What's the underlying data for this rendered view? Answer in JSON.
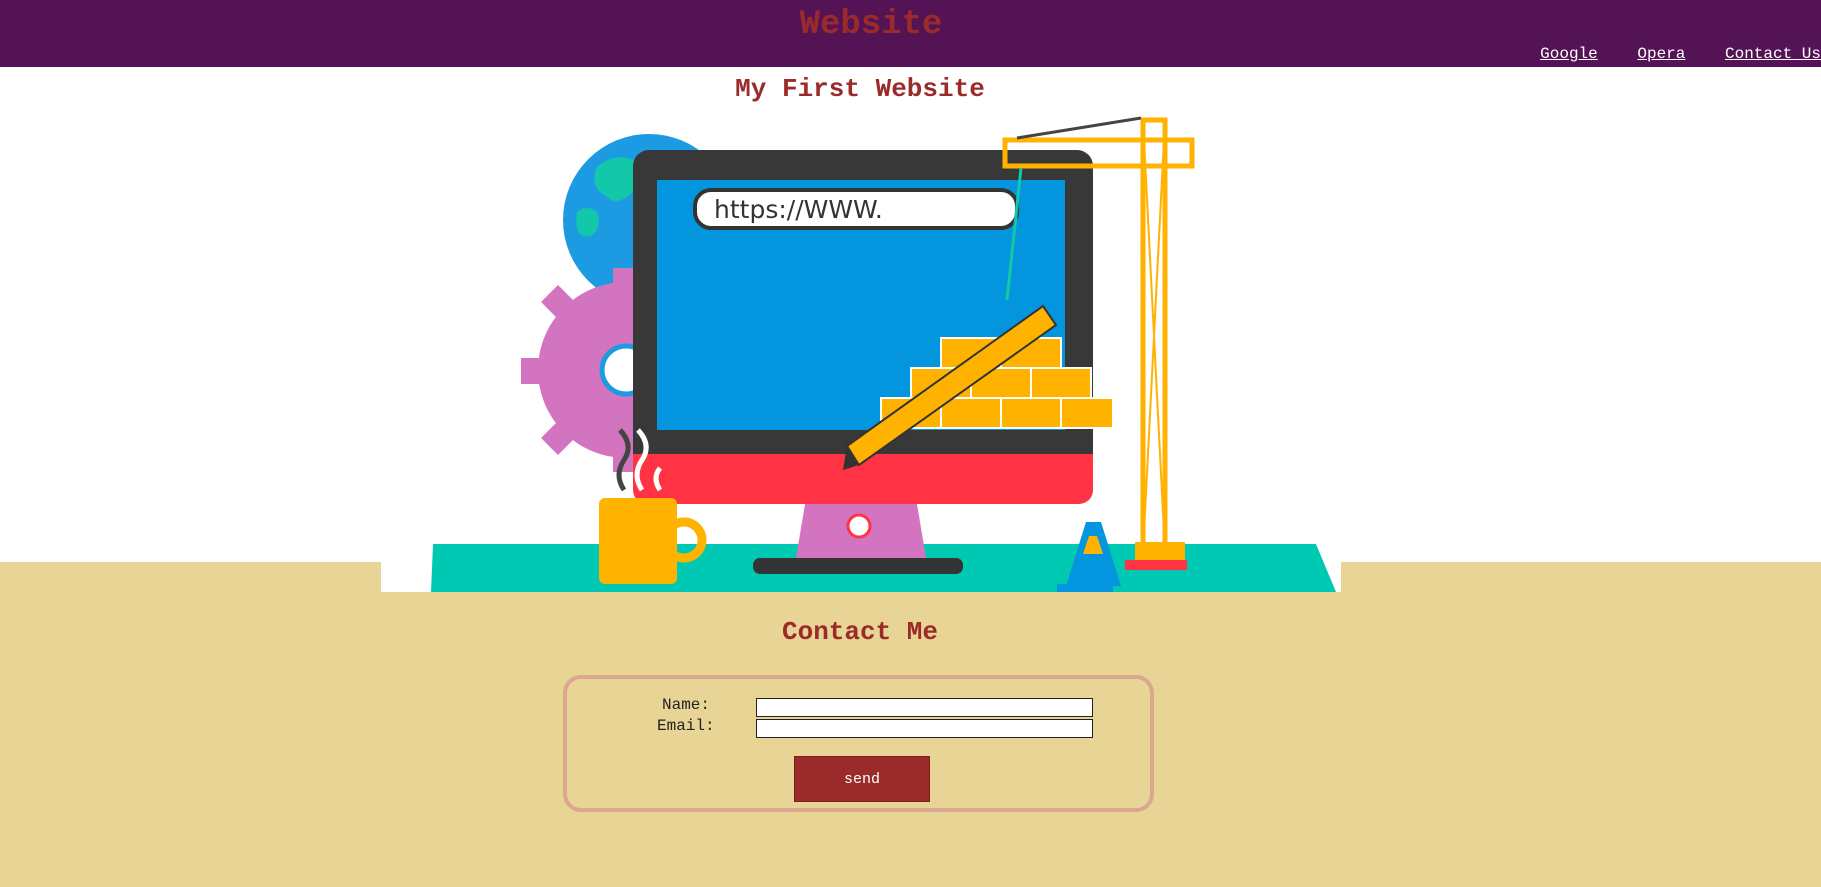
{
  "header": {
    "title": "Website",
    "nav": [
      "Google",
      "Opera",
      "Contact Us"
    ]
  },
  "main": {
    "title": "My First Website",
    "hero": {
      "url_text": "https://WWW."
    }
  },
  "contact": {
    "title": "Contact Me",
    "name_label": "Name:",
    "email_label": "Email:",
    "name_value": "",
    "email_value": "",
    "send_label": "send"
  },
  "colors": {
    "header_bg": "#541354",
    "title_red": "#9b2b2b",
    "page_bg": "#e8d494",
    "form_border": "#d8a890"
  }
}
